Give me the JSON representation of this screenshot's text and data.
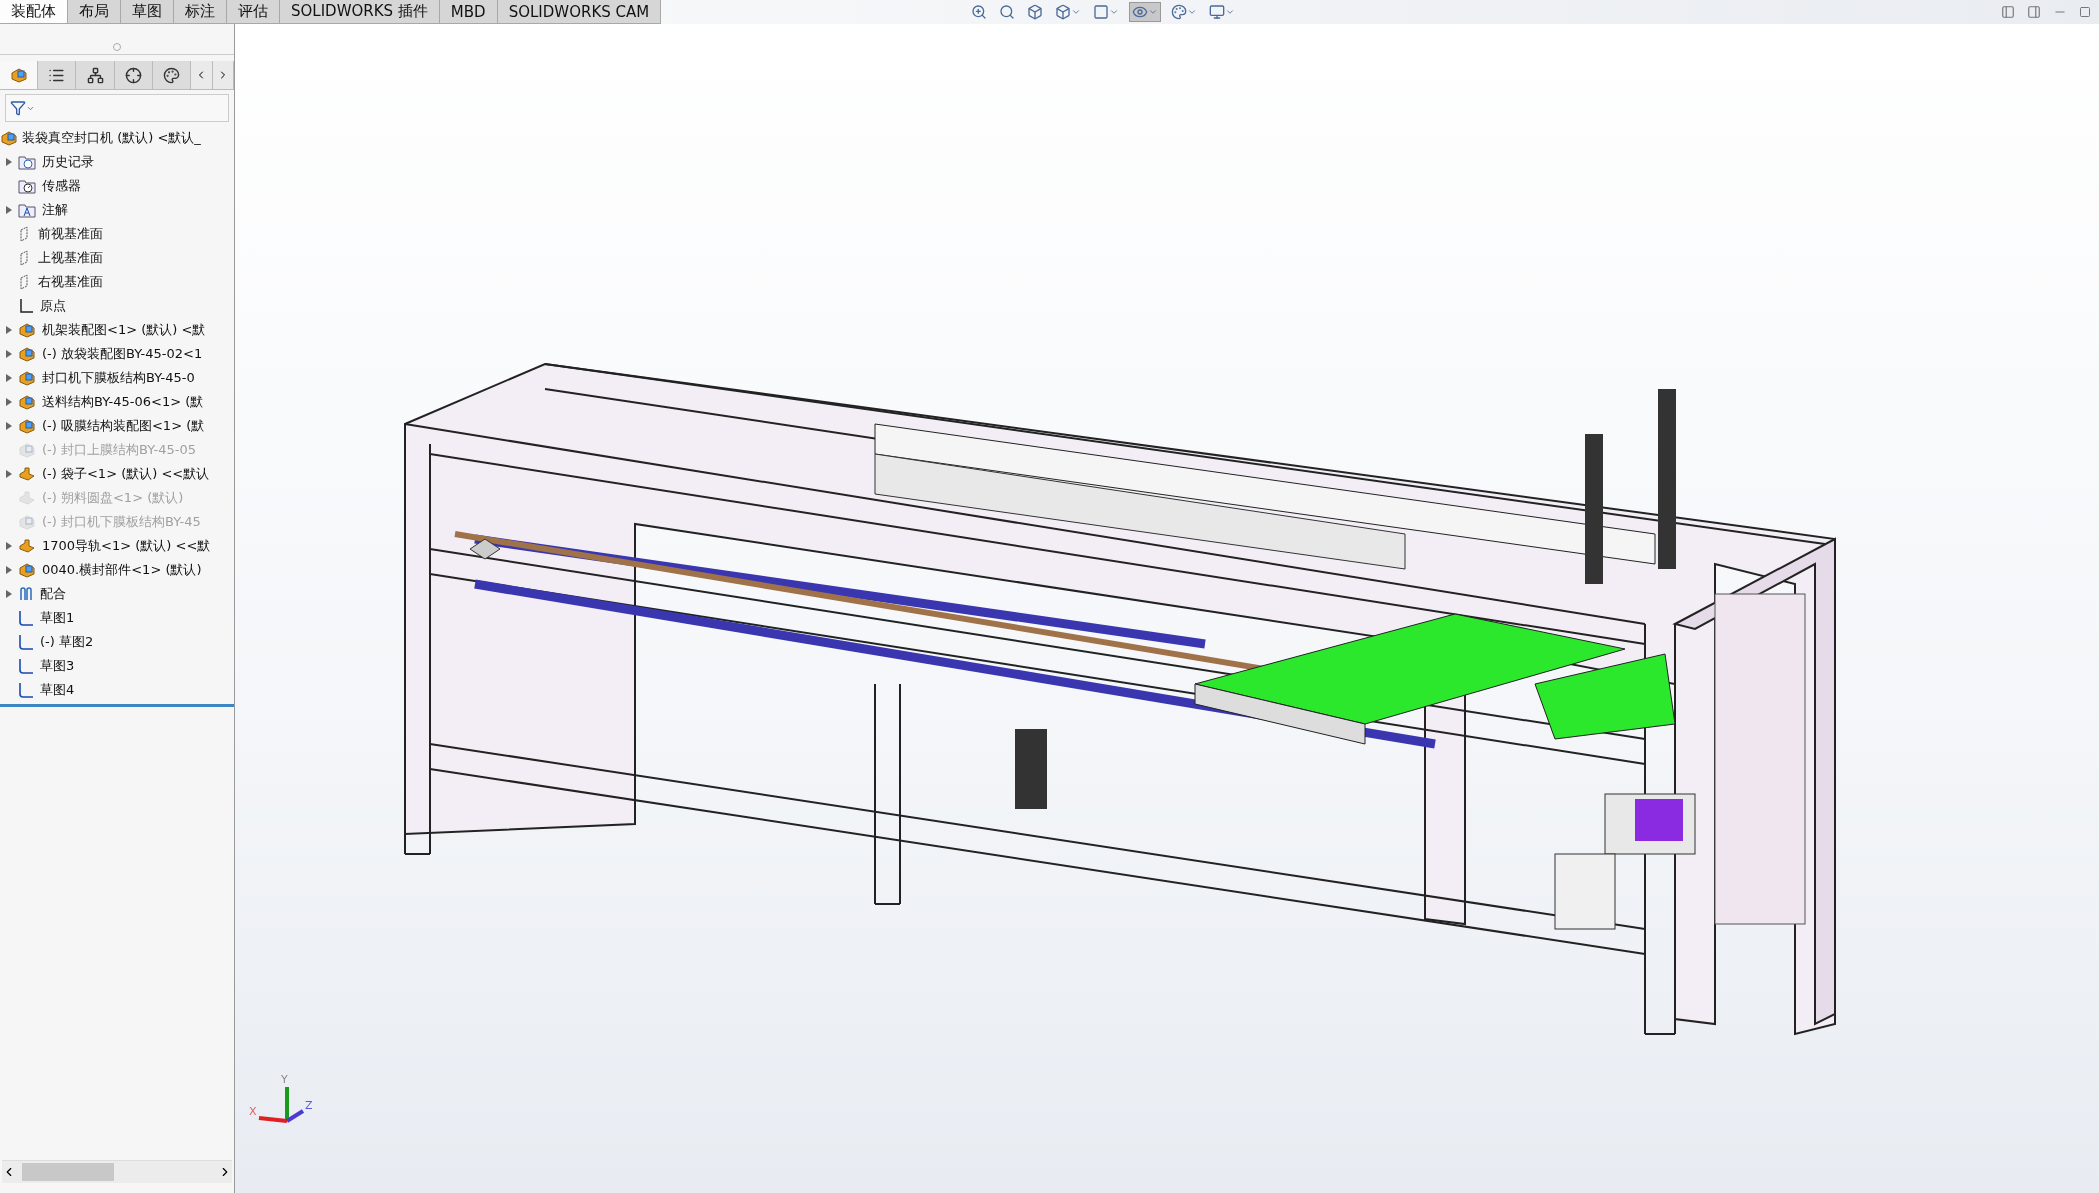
{
  "command_tabs": [
    {
      "label": "装配体",
      "selected": true
    },
    {
      "label": "布局",
      "selected": false
    },
    {
      "label": "草图",
      "selected": false
    },
    {
      "label": "标注",
      "selected": false
    },
    {
      "label": "评估",
      "selected": false
    },
    {
      "label": "SOLIDWORKS 插件",
      "selected": false
    },
    {
      "label": "MBD",
      "selected": false
    },
    {
      "label": "SOLIDWORKS CAM",
      "selected": false
    }
  ],
  "panel_tabs": [
    {
      "kind": "feature",
      "selected": true
    },
    {
      "kind": "property",
      "selected": false
    },
    {
      "kind": "config",
      "selected": false
    },
    {
      "kind": "dimxpert",
      "selected": false
    },
    {
      "kind": "display",
      "selected": false
    }
  ],
  "tree": {
    "root": "装袋真空封口机 (默认) <默认_",
    "items": [
      {
        "label": "历史记录",
        "kind": "history",
        "expandable": true,
        "suppressed": false
      },
      {
        "label": "传感器",
        "kind": "sensor",
        "expandable": false,
        "suppressed": false
      },
      {
        "label": "注解",
        "kind": "annotation",
        "expandable": true,
        "suppressed": false
      },
      {
        "label": "前视基准面",
        "kind": "plane",
        "expandable": false,
        "suppressed": false
      },
      {
        "label": "上视基准面",
        "kind": "plane",
        "expandable": false,
        "suppressed": false
      },
      {
        "label": "右视基准面",
        "kind": "plane",
        "expandable": false,
        "suppressed": false
      },
      {
        "label": "原点",
        "kind": "origin",
        "expandable": false,
        "suppressed": false
      },
      {
        "label": "机架装配图<1> (默认) <默",
        "kind": "assembly",
        "expandable": true,
        "suppressed": false
      },
      {
        "label": "(-) 放袋装配图BY-45-02<1",
        "kind": "assembly",
        "expandable": true,
        "suppressed": false
      },
      {
        "label": "封口机下膜板结构BY-45-0",
        "kind": "assembly",
        "expandable": true,
        "suppressed": false
      },
      {
        "label": "送料结构BY-45-06<1> (默",
        "kind": "assembly",
        "expandable": true,
        "suppressed": false
      },
      {
        "label": "(-) 吸膜结构装配图<1> (默",
        "kind": "assembly",
        "expandable": true,
        "suppressed": false
      },
      {
        "label": "(-) 封口上膜结构BY-45-05",
        "kind": "assembly",
        "expandable": false,
        "suppressed": true
      },
      {
        "label": "(-) 袋子<1> (默认) <<默认",
        "kind": "part",
        "expandable": true,
        "suppressed": false
      },
      {
        "label": "(-) 朔料圆盘<1> (默认)",
        "kind": "part",
        "expandable": false,
        "suppressed": true
      },
      {
        "label": "(-) 封口机下膜板结构BY-45",
        "kind": "assembly",
        "expandable": false,
        "suppressed": true
      },
      {
        "label": "1700导轨<1> (默认) <<默",
        "kind": "part",
        "expandable": true,
        "suppressed": false
      },
      {
        "label": "0040.横封部件<1> (默认)",
        "kind": "assembly",
        "expandable": true,
        "suppressed": false
      },
      {
        "label": "配合",
        "kind": "mates",
        "expandable": true,
        "suppressed": false
      },
      {
        "label": "草图1",
        "kind": "sketch",
        "expandable": false,
        "suppressed": false
      },
      {
        "label": "(-) 草图2",
        "kind": "sketch",
        "expandable": false,
        "suppressed": false
      },
      {
        "label": "草图3",
        "kind": "sketch",
        "expandable": false,
        "suppressed": false
      },
      {
        "label": "草图4",
        "kind": "sketch",
        "expandable": false,
        "suppressed": false
      }
    ]
  },
  "triad": {
    "x": "X",
    "y": "Y",
    "z": "Z"
  }
}
